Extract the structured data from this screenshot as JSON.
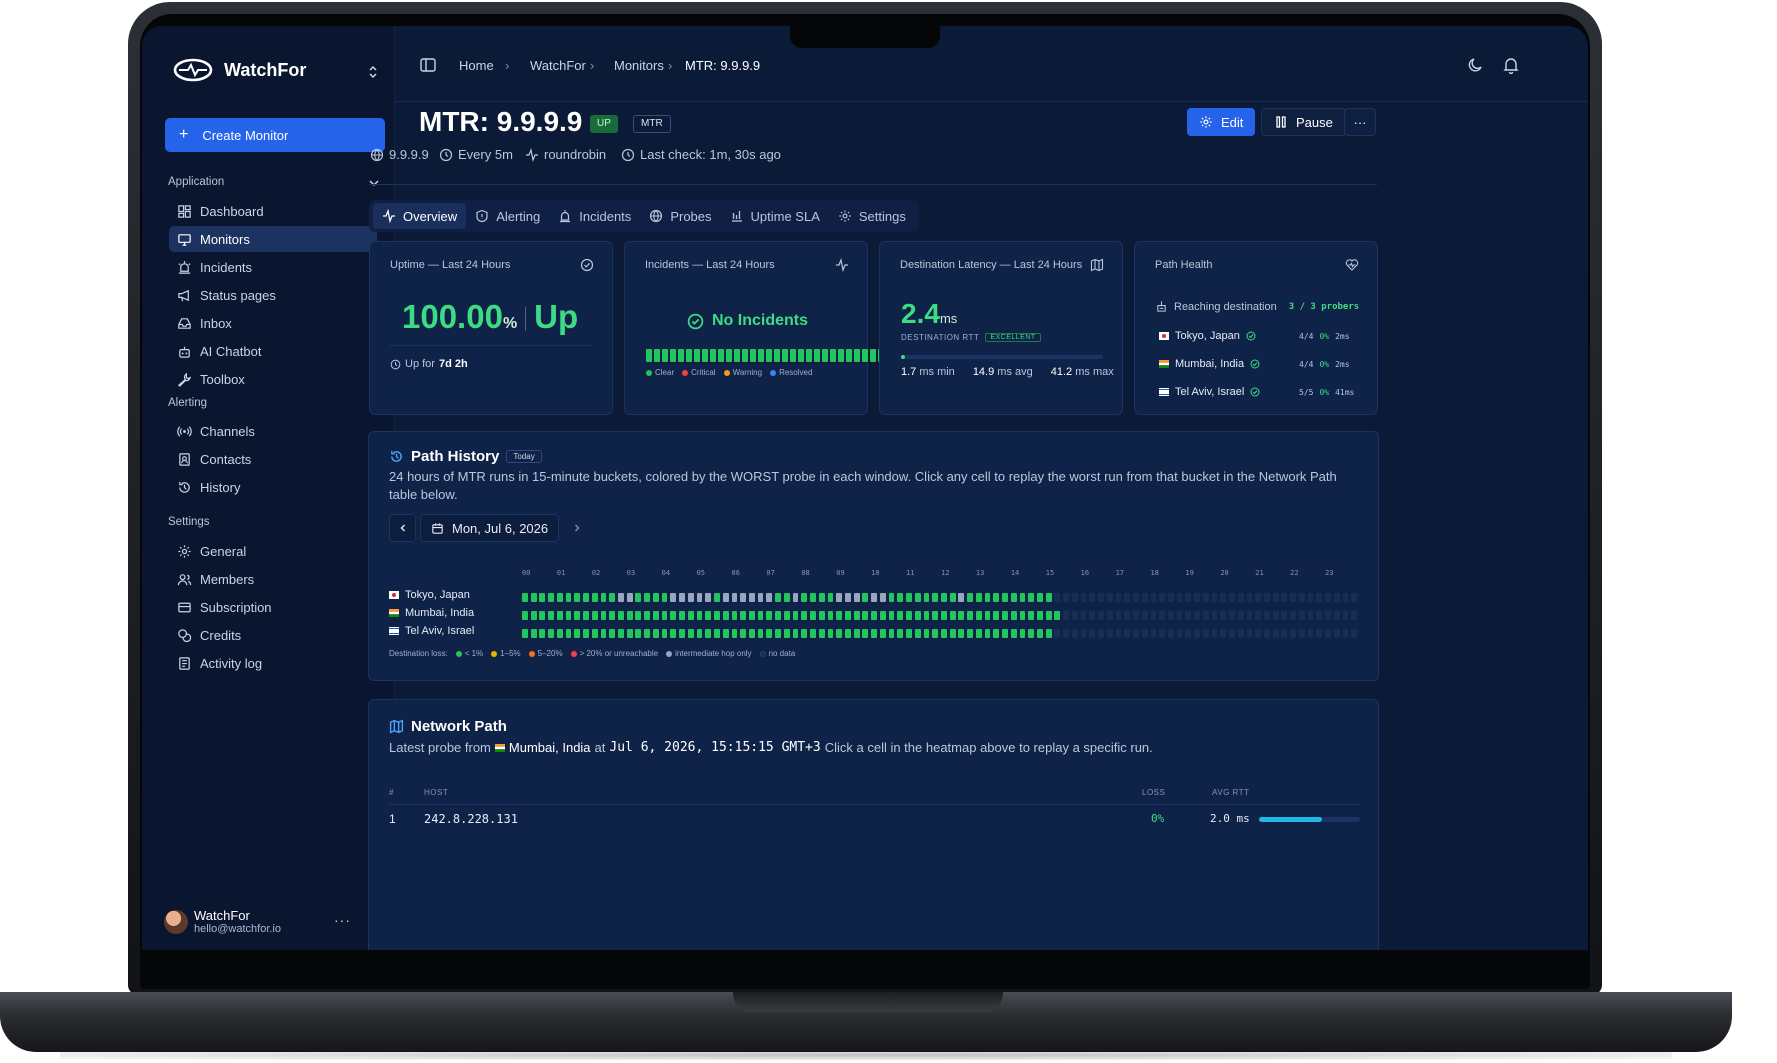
{
  "brand": {
    "name": "WatchFor"
  },
  "sidebar": {
    "create_label": "Create Monitor",
    "sections": {
      "application": "Application",
      "alerting": "Alerting",
      "settings": "Settings"
    },
    "application_items": [
      "Dashboard",
      "Monitors",
      "Incidents",
      "Status pages",
      "Inbox",
      "AI Chatbot",
      "Toolbox"
    ],
    "alerting_items": [
      "Channels",
      "Contacts",
      "History"
    ],
    "settings_items": [
      "General",
      "Members",
      "Subscription",
      "Credits",
      "Activity log"
    ],
    "active_item": "Monitors"
  },
  "user": {
    "name": "WatchFor",
    "email": "hello@watchfor.io",
    "more": "···"
  },
  "breadcrumb": [
    "Home",
    "WatchFor",
    "Monitors",
    "MTR: 9.9.9.9"
  ],
  "monitor": {
    "title": "MTR: 9.9.9.9",
    "status_badge": "UP",
    "type_badge": "MTR",
    "target": "9.9.9.9",
    "interval": "Every 5m",
    "strategy": "roundrobin",
    "last_check": "Last check: 1m, 30s ago"
  },
  "actions": {
    "edit": "Edit",
    "pause": "Pause",
    "more": "···"
  },
  "tabs": [
    "Overview",
    "Alerting",
    "Incidents",
    "Probes",
    "Uptime SLA",
    "Settings"
  ],
  "active_tab": "Overview",
  "cards": {
    "uptime": {
      "title": "Uptime — Last 24 Hours",
      "value": "100.00",
      "unit": "%",
      "status": "Up",
      "up_for_label": "Up for",
      "up_for_value": "7d 2h"
    },
    "incidents": {
      "title": "Incidents — Last 24 Hours",
      "status": "No Incidents",
      "bar_count": 30,
      "legend": [
        "Clear",
        "Critical",
        "Warning",
        "Resolved"
      ]
    },
    "latency": {
      "title": "Destination Latency — Last 24 Hours",
      "value": "2.4",
      "unit": "ms",
      "rtt_label": "DESTINATION RTT",
      "rating": "EXCELLENT",
      "level": 0.02,
      "min_value": "1.7",
      "min_label": "ms min",
      "avg_value": "14.9",
      "avg_label": "ms avg",
      "max_value": "41.2",
      "max_label": "ms max"
    },
    "path_health": {
      "title": "Path Health",
      "reaching_label": "Reaching destination",
      "reaching_value": "3 / 3 probers",
      "probes": [
        {
          "location": "Tokyo, Japan",
          "hops": "4/4",
          "loss": "0%",
          "rtt": "2ms"
        },
        {
          "location": "Mumbai, India",
          "hops": "4/4",
          "loss": "0%",
          "rtt": "2ms"
        },
        {
          "location": "Tel Aviv, Israel",
          "hops": "5/5",
          "loss": "0%",
          "rtt": "41ms"
        }
      ]
    }
  },
  "path_history": {
    "title": "Path History",
    "badge": "Today",
    "description": "24 hours of MTR runs in 15-minute buckets, colored by the WORST probe in each window. Click any cell to replay the worst run from that bucket in the Network Path table below.",
    "date": "Mon, Jul 6, 2026",
    "hours": [
      "00",
      "01",
      "02",
      "03",
      "04",
      "05",
      "06",
      "07",
      "08",
      "09",
      "10",
      "11",
      "12",
      "13",
      "14",
      "15",
      "16",
      "17",
      "18",
      "19",
      "20",
      "21",
      "22",
      "23"
    ],
    "rows": [
      {
        "location": "Tokyo, Japan",
        "filled_buckets": 61,
        "grey_buckets": [
          11,
          12,
          17,
          18,
          19,
          20,
          21,
          23,
          24,
          25,
          26,
          27,
          28,
          31,
          36,
          37,
          38,
          40,
          41,
          50
        ]
      },
      {
        "location": "Mumbai, India",
        "filled_buckets": 62,
        "grey_buckets": []
      },
      {
        "location": "Tel Aviv, Israel",
        "filled_buckets": 61,
        "grey_buckets": []
      }
    ],
    "total_buckets": 96,
    "legend_label": "Destination loss:",
    "legend": [
      "< 1%",
      "1–5%",
      "5–20%",
      "> 20% or unreachable",
      "intermediate hop only",
      "no data"
    ],
    "colors": {
      "good": "#22c55e",
      "warn": "#eab308",
      "bad": "#f97316",
      "critical": "#ef4444",
      "intermediate": "#9aa6bf",
      "nodata": "#1a2d55"
    }
  },
  "network_path": {
    "title": "Network Path",
    "desc_prefix": "Latest probe from",
    "desc_location": "Mumbai, India",
    "desc_at": "at",
    "desc_time": "Jul 6, 2026, 15:15:15 GMT+3",
    "desc_suffix": "Click a cell in the heatmap above to replay a specific run.",
    "columns": {
      "num": "#",
      "host": "HOST",
      "loss": "LOSS",
      "avg_rtt": "AVG RTT"
    },
    "rows": [
      {
        "num": "1",
        "host": "242.8.228.131",
        "loss": "0%",
        "avg_rtt": "2.0 ms",
        "rtt_fraction": 0.62
      }
    ]
  },
  "colors": {
    "accent": "#2563eb",
    "success": "#3ddc84",
    "background": "#0b1a37"
  }
}
